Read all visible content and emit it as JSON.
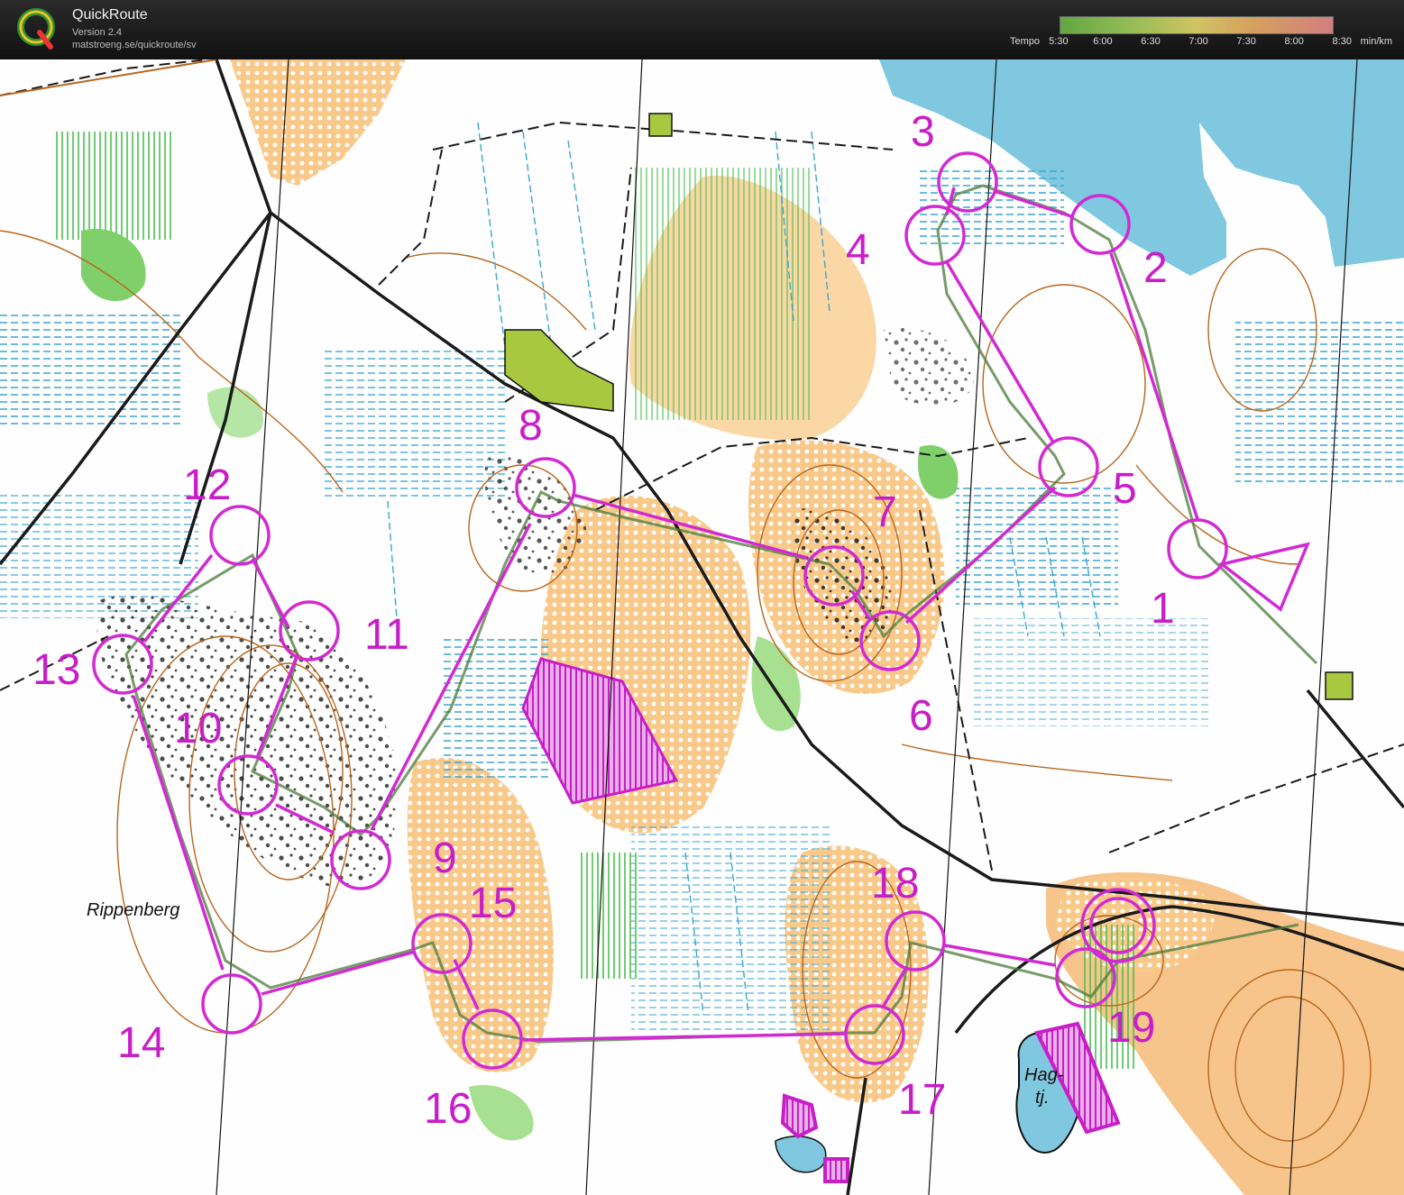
{
  "app": {
    "title": "QuickRoute",
    "version": "Version 2.4",
    "url": "matstroeng.se/quickroute/sv"
  },
  "tempo": {
    "label": "Tempo",
    "ticks": [
      "5:30",
      "6:00",
      "6:30",
      "7:00",
      "7:30",
      "8:00",
      "8:30"
    ],
    "unit": "min/km"
  },
  "map": {
    "place_names": [
      "Rippenberg",
      "Hag-",
      "tj."
    ],
    "controls": [
      "1",
      "2",
      "3",
      "4",
      "5",
      "6",
      "7",
      "8",
      "9",
      "10",
      "11",
      "12",
      "13",
      "14",
      "15",
      "16",
      "17",
      "18",
      "19"
    ],
    "colors": {
      "course": "#d22ad2",
      "forest": "#ffffff",
      "open": "#f9c98a",
      "water": "#80c8e0",
      "contour": "#b8661e",
      "green": "#7fd06a",
      "track": "#2a2a2a"
    }
  }
}
